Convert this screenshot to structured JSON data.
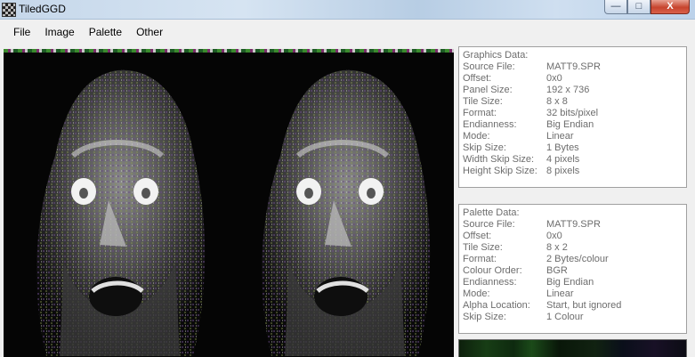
{
  "window": {
    "title": "TiledGGD",
    "controls": {
      "minimize": "—",
      "maximize": "□",
      "close": "X"
    }
  },
  "menu": [
    "File",
    "Image",
    "Palette",
    "Other"
  ],
  "graphics": {
    "heading": "Graphics Data:",
    "rows": [
      {
        "label": "Source File:",
        "value": "MATT9.SPR"
      },
      {
        "label": "Offset:",
        "value": "0x0"
      },
      {
        "label": "Panel Size:",
        "value": "192 x 736"
      },
      {
        "label": "Tile Size:",
        "value": "8 x 8"
      },
      {
        "label": "Format:",
        "value": "32 bits/pixel"
      },
      {
        "label": "Endianness:",
        "value": "Big Endian"
      },
      {
        "label": "Mode:",
        "value": "Linear"
      },
      {
        "label": "Skip Size:",
        "value": "1 Bytes"
      },
      {
        "label": "Width Skip Size:",
        "value": "4 pixels"
      },
      {
        "label": "Height Skip Size:",
        "value": "8 pixels"
      }
    ]
  },
  "palette": {
    "heading": "Palette Data:",
    "rows": [
      {
        "label": "Source File:",
        "value": "MATT9.SPR"
      },
      {
        "label": "Offset:",
        "value": "0x0"
      },
      {
        "label": "Tile Size:",
        "value": "8 x 2"
      },
      {
        "label": "Format:",
        "value": "2 Bytes/colour"
      },
      {
        "label": "Colour Order:",
        "value": "BGR"
      },
      {
        "label": "Endianness:",
        "value": "Big Endian"
      },
      {
        "label": "Mode:",
        "value": "Linear"
      },
      {
        "label": "Alpha Location:",
        "value": "Start, but ignored"
      },
      {
        "label": "Skip Size:",
        "value": "1 Colour"
      }
    ]
  },
  "colors": {
    "info_text": "#6d6d6d",
    "canvas_bg": "#050505"
  }
}
